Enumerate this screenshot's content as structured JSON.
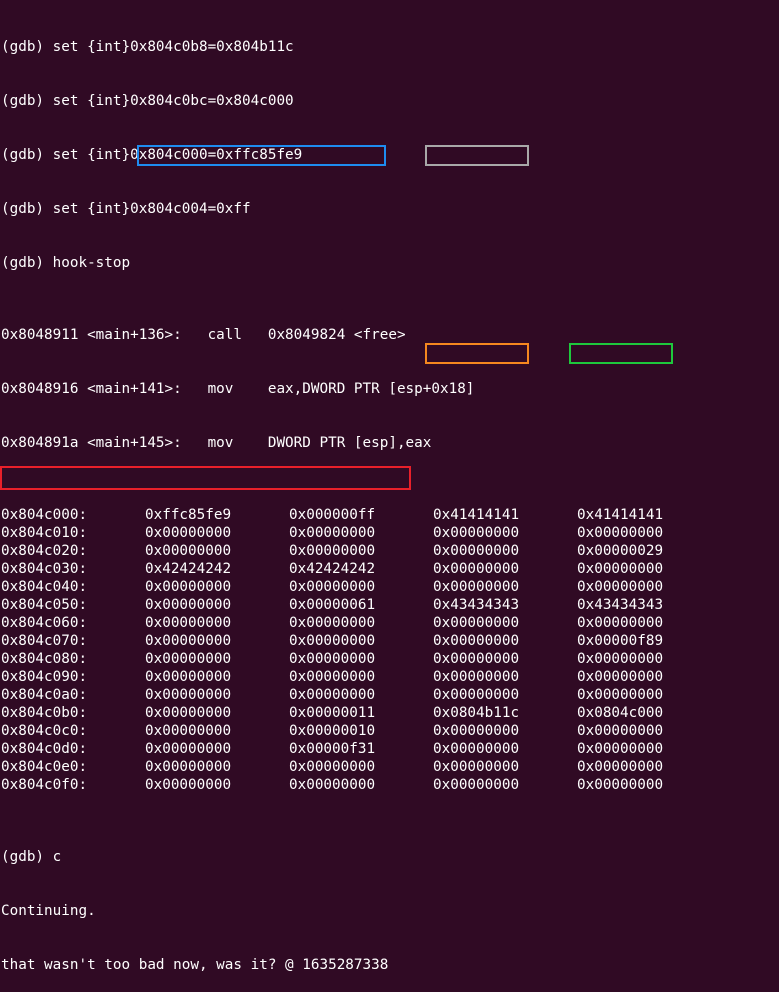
{
  "terminal": {
    "commands": [
      "(gdb) set {int}0x804c0b8=0x804b11c",
      "(gdb) set {int}0x804c0bc=0x804c000",
      "(gdb) set {int}0x804c000=0xffc85fe9",
      "(gdb) set {int}0x804c004=0xff",
      "(gdb) hook-stop"
    ],
    "disassembly": [
      "0x8048911 <main+136>:   call   0x8049824 <free>",
      "0x8048916 <main+141>:   mov    eax,DWORD PTR [esp+0x18]",
      "0x804891a <main+145>:   mov    DWORD PTR [esp],eax"
    ],
    "memory_rows": [
      {
        "addr": "0x804c000:",
        "words": [
          "0xffc85fe9",
          "0x000000ff",
          "0x41414141",
          "0x41414141"
        ]
      },
      {
        "addr": "0x804c010:",
        "words": [
          "0x00000000",
          "0x00000000",
          "0x00000000",
          "0x00000000"
        ]
      },
      {
        "addr": "0x804c020:",
        "words": [
          "0x00000000",
          "0x00000000",
          "0x00000000",
          "0x00000029"
        ]
      },
      {
        "addr": "0x804c030:",
        "words": [
          "0x42424242",
          "0x42424242",
          "0x00000000",
          "0x00000000"
        ]
      },
      {
        "addr": "0x804c040:",
        "words": [
          "0x00000000",
          "0x00000000",
          "0x00000000",
          "0x00000000"
        ]
      },
      {
        "addr": "0x804c050:",
        "words": [
          "0x00000000",
          "0x00000061",
          "0x43434343",
          "0x43434343"
        ]
      },
      {
        "addr": "0x804c060:",
        "words": [
          "0x00000000",
          "0x00000000",
          "0x00000000",
          "0x00000000"
        ]
      },
      {
        "addr": "0x804c070:",
        "words": [
          "0x00000000",
          "0x00000000",
          "0x00000000",
          "0x00000f89"
        ]
      },
      {
        "addr": "0x804c080:",
        "words": [
          "0x00000000",
          "0x00000000",
          "0x00000000",
          "0x00000000"
        ]
      },
      {
        "addr": "0x804c090:",
        "words": [
          "0x00000000",
          "0x00000000",
          "0x00000000",
          "0x00000000"
        ]
      },
      {
        "addr": "0x804c0a0:",
        "words": [
          "0x00000000",
          "0x00000000",
          "0x00000000",
          "0x00000000"
        ]
      },
      {
        "addr": "0x804c0b0:",
        "words": [
          "0x00000000",
          "0x00000011",
          "0x0804b11c",
          "0x0804c000"
        ]
      },
      {
        "addr": "0x804c0c0:",
        "words": [
          "0x00000000",
          "0x00000010",
          "0x00000000",
          "0x00000000"
        ]
      },
      {
        "addr": "0x804c0d0:",
        "words": [
          "0x00000000",
          "0x00000f31",
          "0x00000000",
          "0x00000000"
        ]
      },
      {
        "addr": "0x804c0e0:",
        "words": [
          "0x00000000",
          "0x00000000",
          "0x00000000",
          "0x00000000"
        ]
      },
      {
        "addr": "0x804c0f0:",
        "words": [
          "0x00000000",
          "0x00000000",
          "0x00000000",
          "0x00000000"
        ]
      }
    ],
    "continue_cmd": "(gdb) c",
    "continuing": "Continuing.",
    "winner_output": "that wasn't too bad now, was it? @ 1635287338"
  },
  "colors": {
    "background": "#300a24",
    "text": "#ffffff",
    "box_blue": "#1e8cf0",
    "box_gray": "#a8a8a8",
    "box_orange": "#f5871f",
    "box_green": "#1ec83c",
    "box_red": "#e8202a"
  }
}
